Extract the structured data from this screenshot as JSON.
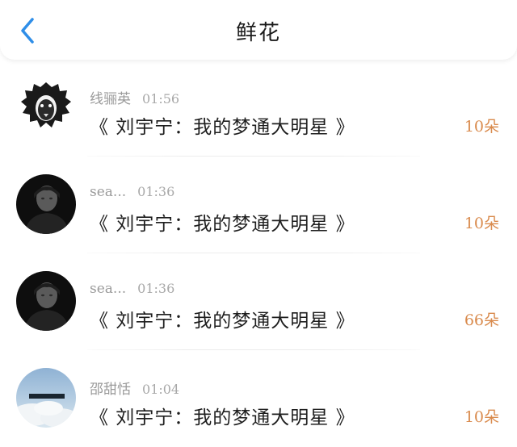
{
  "header": {
    "title": "鲜花"
  },
  "records": [
    {
      "user": "线骊英",
      "time": "01:56",
      "book": "《 刘宇宁：我的梦通大明星 》",
      "count": "10朵"
    },
    {
      "user": "sea...",
      "time": "01:36",
      "book": "《 刘宇宁：我的梦通大明星 》",
      "count": "10朵"
    },
    {
      "user": "sea...",
      "time": "01:36",
      "book": "《 刘宇宁：我的梦通大明星 》",
      "count": "66朵"
    },
    {
      "user": "邵甜恬",
      "time": "01:04",
      "book": "《 刘宇宁：我的梦通大明星 》",
      "count": "10朵"
    }
  ],
  "colors": {
    "accent_back": "#2f8ee8",
    "count": "#d98a4c"
  }
}
